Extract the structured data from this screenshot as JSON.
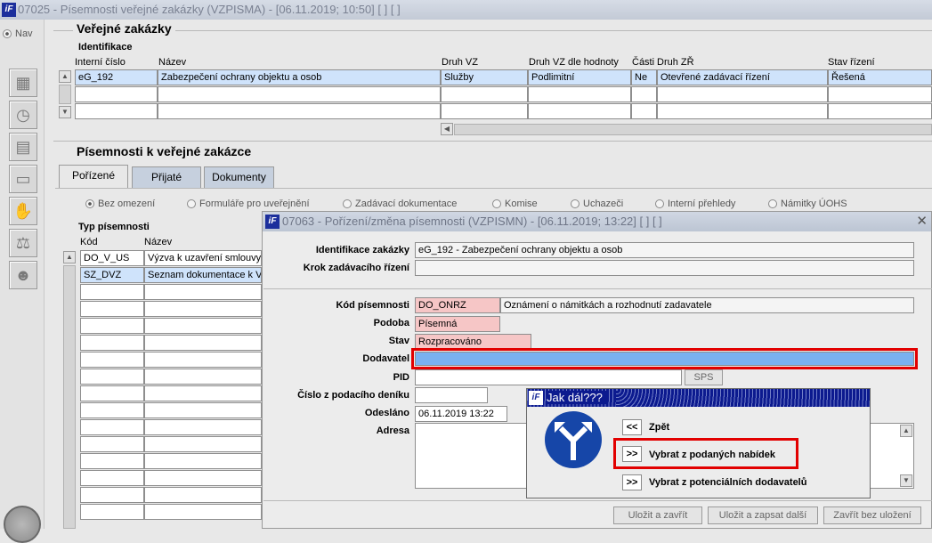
{
  "main_window": {
    "title": "07025 - Písemnosti veřejné zakázky (VZPISMA) - [06.11.2019; 10:50]  [ ]  [ ]",
    "nav_label": "Nav"
  },
  "verejne_zakazky": {
    "section_title": "Veřejné zakázky",
    "subsection": "Identifikace",
    "columns": [
      "Interní číslo",
      "Název",
      "Druh VZ",
      "Druh VZ dle hodnoty",
      "Části",
      "Druh ZŘ",
      "Stav řízení"
    ],
    "row": [
      "eG_192",
      "Zabezpečení ochrany objektu a osob",
      "Služby",
      "Podlimitní",
      "Ne",
      "Otevřené zadávací řízení",
      "Řešená"
    ]
  },
  "pisemnosti": {
    "section_title": "Písemnosti k veřejné zakázce",
    "tabs": [
      "Pořízené",
      "Přijaté",
      "Dokumenty"
    ],
    "filters": [
      "Bez omezení",
      "Formuláře pro uveřejnění",
      "Zadávací dokumentace",
      "Komise",
      "Uchazeči",
      "Interní přehledy",
      "Námitky ÚOHS"
    ],
    "list_title": "Typ písemnosti",
    "list_columns": [
      "Kód",
      "Název"
    ],
    "rows": [
      {
        "kod": "DO_V_US",
        "nazev": "Výzva k uzavření smlouvy"
      },
      {
        "kod": "SZ_DVZ",
        "nazev": "Seznam dokumentace k VZ"
      }
    ]
  },
  "dialog": {
    "title": "07063 - Pořízení/změna písemnosti (VZPISMN) - [06.11.2019; 13:22]  [ ]  [ ]",
    "labels": {
      "identifikace": "Identifikace zakázky",
      "krok": "Krok zadávacího řízení",
      "kod": "Kód písemnosti",
      "podoba": "Podoba",
      "stav": "Stav",
      "dodavatel": "Dodavatel",
      "pid": "PID",
      "cislo": "Číslo z podacího deníku",
      "odeslano": "Odesláno",
      "adresa": "Adresa"
    },
    "values": {
      "identifikace": "eG_192 - Zabezpečení ochrany objektu a osob",
      "krok": "",
      "kod": "DO_ONRZ",
      "kod_nazev": "Oznámení o námitkách a rozhodnutí zadavatele",
      "podoba": "Písemná",
      "stav": "Rozpracováno",
      "dodavatel": "",
      "pid": "",
      "cislo": "",
      "odeslano": "06.11.2019 13:22",
      "adresa": ""
    },
    "sps_button": "SPS",
    "buttons": [
      "Uložit a zavřít",
      "Uložit a zapsat další",
      "Zavřít bez uložení"
    ]
  },
  "popup": {
    "title": "Jak dál???",
    "options": [
      {
        "button": "<<",
        "label": "Zpět"
      },
      {
        "button": ">>",
        "label": "Vybrat z podaných nabídek"
      },
      {
        "button": ">>",
        "label": "Vybrat z potenciálních dodavatelů"
      }
    ]
  },
  "colors": {
    "highlight": "#e20000",
    "selected_field": "#7ab1f0",
    "mandatory": "#f6c6c6"
  }
}
